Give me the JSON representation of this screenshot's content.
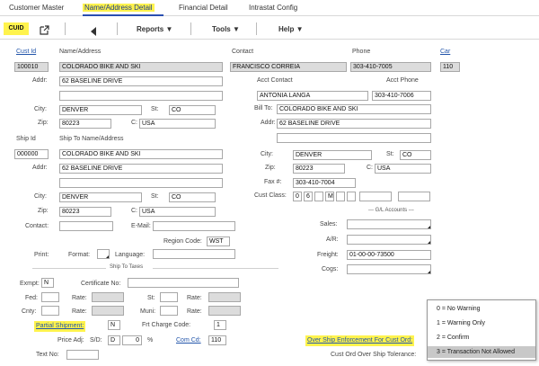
{
  "tabs": [
    {
      "label": "Customer Master"
    },
    {
      "label": "Name/Address Detail"
    },
    {
      "label": "Financial Detail"
    },
    {
      "label": "Intrastat Config"
    }
  ],
  "toolbar": {
    "cuid": "CUID",
    "reports": "Reports",
    "tools": "Tools",
    "help": "Help"
  },
  "headers": {
    "cust_id": "Cust Id",
    "name_address": "Name/Address",
    "contact": "Contact",
    "phone": "Phone",
    "car": "Car"
  },
  "customer": {
    "cust_id": "100010",
    "name": "COLORADO BIKE AND SKI",
    "addr": "62 BASELINE DRIVE",
    "addr2": "",
    "city": "DENVER",
    "st": "CO",
    "zip": "80223",
    "country": "USA",
    "contact": "FRANCISCO CORREIA",
    "phone": "303-410-7005",
    "car": "110"
  },
  "labels": {
    "addr": "Addr:",
    "city": "City:",
    "st": "St:",
    "zip": "Zip:",
    "c": "C:",
    "ship_id": "Ship Id",
    "ship_to": "Ship To Name/Address",
    "acct_contact": "Acct Contact",
    "acct_phone": "Acct Phone",
    "bill_to": "Bill To:",
    "fax": "Fax #:",
    "cust_class": "Cust Class:",
    "gl_accounts": "--- G/L Accounts ---",
    "contact": "Contact:",
    "email": "E-Mail:",
    "region_code": "Region Code:",
    "sales": "Sales:",
    "ar": "A/R:",
    "print": "Print:",
    "format": "Format:",
    "language": "Language:",
    "freight": "Freight:",
    "cogs": "Cogs:",
    "ship_to_taxes": "Ship To Taxes",
    "exmpt": "Exmpt:",
    "cert_no": "Certificate No:",
    "fed": "Fed:",
    "rate": "Rate:",
    "cnty": "Cnty:",
    "muni": "Muni:",
    "partial_shipment": "Partial Shipment:",
    "frt_charge_code": "Frt Charge Code:",
    "price_adj": "Price Adj:",
    "s_d": "S/D:",
    "pct": "%",
    "com_cd": "Com Cd:",
    "text_no": "Text No:",
    "over_ship_enf": "Over Ship Enforcement For Cust Ord:",
    "over_ship_tol": "Cust Ord Over Ship Tolerance:"
  },
  "acct": {
    "contact": "ANTONIA LANGA",
    "phone": "303-410-7006"
  },
  "bill_to": {
    "name": "COLORADO BIKE AND SKI",
    "addr": "62 BASELINE DRIVE",
    "addr2": "",
    "city": "DENVER",
    "st": "CO",
    "zip": "80223",
    "country": "USA",
    "fax": "303-410-7004"
  },
  "ship_to": {
    "ship_id": "000000",
    "name": "COLORADO BIKE AND SKI",
    "addr": "62 BASELINE DRIVE",
    "addr2": "",
    "city": "DENVER",
    "st": "CO",
    "zip": "80223",
    "country": "USA"
  },
  "cust_class": [
    "0",
    "6",
    "",
    "M",
    "",
    ""
  ],
  "misc": {
    "region_code": "WST",
    "freight_gl": "01-00-00-73500",
    "exmpt": "N",
    "partial_shipment": "N",
    "frt_charge_code": "1",
    "s_d": "D",
    "pct_value": "0",
    "com_cd": "110"
  },
  "popup": {
    "options": [
      "0 = No Warning",
      "1 = Warning Only",
      "2 = Confirm",
      "3 = Transaction Not Allowed"
    ],
    "selected_index": 3
  },
  "colors": {
    "highlight": "#fff34d",
    "active_tab": "#2a4fb0",
    "readonly_field": "#dcdcdc"
  }
}
